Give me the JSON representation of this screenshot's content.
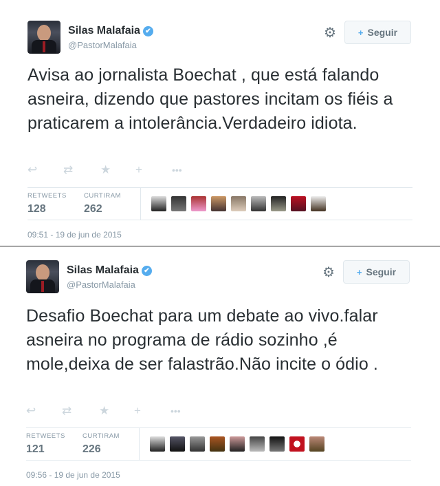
{
  "tweets": [
    {
      "author": {
        "name": "Silas Malafaia",
        "handle": "@PastorMalafaia"
      },
      "follow_label": "Seguir",
      "text": "Avisa ao jornalista Boechat , que está falando asneira, dizendo que pastores incitam os fiéis a praticarem a intolerância.Verdadeiro idiota.",
      "stats": {
        "retweets_label": "RETWEETS",
        "retweets": "128",
        "likes_label": "CURTIRAM",
        "likes": "262"
      },
      "timestamp": "09:51 - 19 de jun de 2015"
    },
    {
      "author": {
        "name": "Silas Malafaia",
        "handle": "@PastorMalafaia"
      },
      "follow_label": "Seguir",
      "text": "Desafio Boechat para um debate ao vivo.falar asneira no programa de rádio sozinho ,é mole,deixa de ser falastrão.Não incite o ódio .",
      "stats": {
        "retweets_label": "RETWEETS",
        "retweets": "121",
        "likes_label": "CURTIRAM",
        "likes": "226"
      },
      "timestamp": "09:56 - 19 de jun de 2015"
    }
  ],
  "icons": {
    "verified": "✔",
    "gear": "⚙",
    "follow_plus": "+",
    "reply": "↩",
    "retweet": "⇄",
    "favorite": "★",
    "follow_action": "+",
    "more": "•••"
  },
  "colors": {
    "verified": "#55acee",
    "text": "#292f33",
    "muted": "#8899a6",
    "border": "#e1e8ed",
    "follow_bg": "#f5f8fa"
  }
}
